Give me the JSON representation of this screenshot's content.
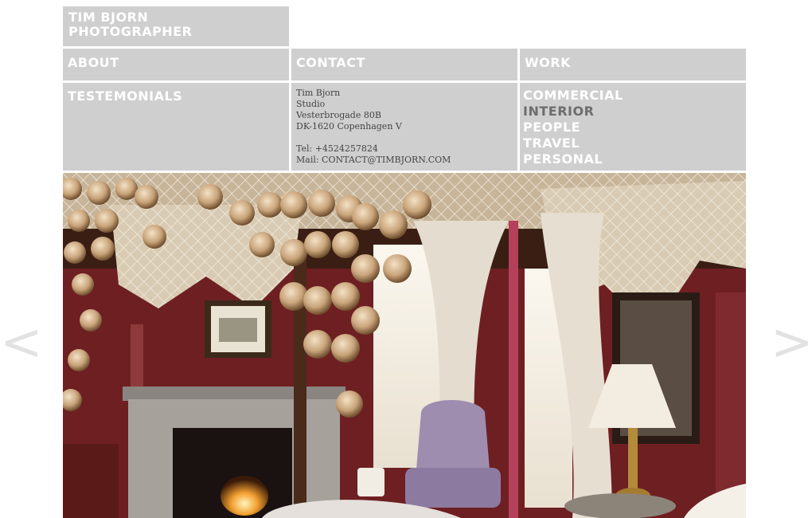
{
  "header": {
    "name_line1": "TIM BJORN",
    "name_line2": "PHOTOGRAPHER"
  },
  "nav": {
    "about": "ABOUT",
    "contact": "CONTACT",
    "work": "WORK",
    "testimonials": "TESTEMONIALS"
  },
  "contact_info": {
    "name": "Tim Bjorn",
    "company": "Studio",
    "street": "Vesterbrogade 80B",
    "city": "DK-1620 Copenhagen V",
    "phone": "Tel: +4524257824",
    "mail": "Mail: CONTACT@TIMBJORN.COM"
  },
  "work_menu": [
    {
      "label": "COMMERCIAL",
      "active": false
    },
    {
      "label": "INTERIOR",
      "active": true
    },
    {
      "label": "PEOPLE",
      "active": false
    },
    {
      "label": "TRAVEL",
      "active": false
    },
    {
      "label": "PERSONAL",
      "active": false
    }
  ],
  "gallery": {
    "prev_label": "<",
    "next_label": ">"
  },
  "colors": {
    "tile": "#cfcfcf",
    "text": "#ffffff",
    "active": "#6d6d6d",
    "arrow": "#e2e2e2"
  }
}
